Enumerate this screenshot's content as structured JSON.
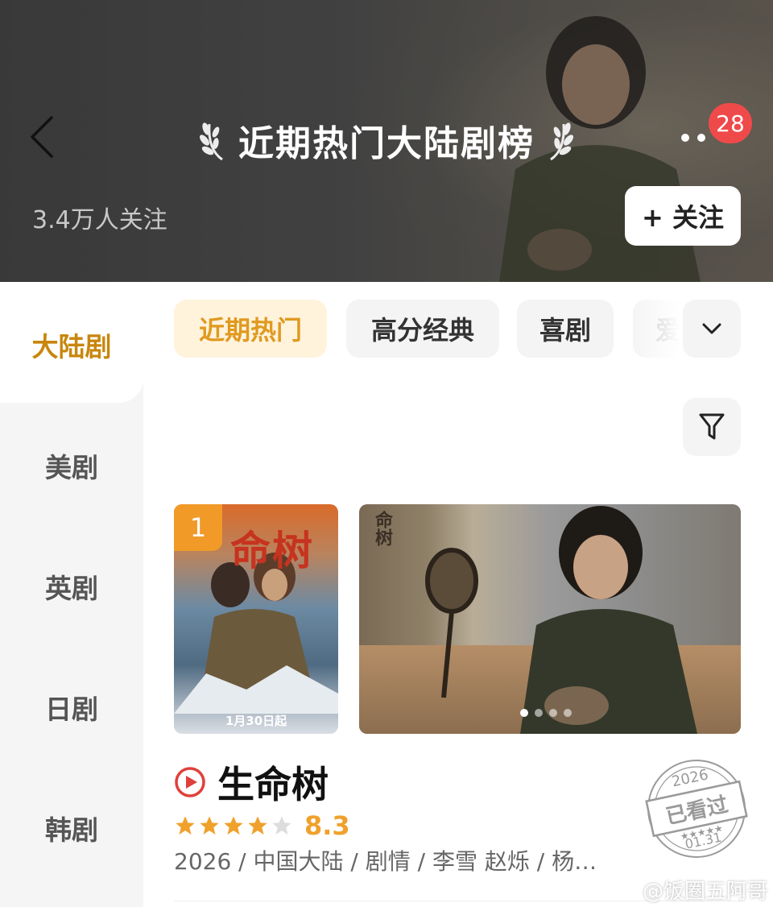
{
  "header": {
    "title": "近期热门大陆剧榜",
    "followers": "3.4万人关注",
    "follow_button": "+ 关注",
    "badge_count": "28"
  },
  "sidebar": {
    "items": [
      {
        "label": "大陆剧",
        "active": true
      },
      {
        "label": "美剧",
        "active": false
      },
      {
        "label": "英剧",
        "active": false
      },
      {
        "label": "日剧",
        "active": false
      },
      {
        "label": "韩剧",
        "active": false
      }
    ]
  },
  "chips": [
    {
      "label": "近期热门",
      "active": true
    },
    {
      "label": "高分经典",
      "active": false
    },
    {
      "label": "喜剧",
      "active": false
    },
    {
      "label": "爱",
      "active": false
    }
  ],
  "icons": {
    "expand": "chevron-down-icon",
    "filter": "filter-icon",
    "back": "back-arrow-icon",
    "more": "more-dots-icon",
    "play": "play-icon"
  },
  "item": {
    "rank": "1",
    "poster_title": "命树",
    "poster_date": "1月30日起",
    "still_text": "命树",
    "title": "生命树",
    "stars": 4,
    "rating": "8.3",
    "meta": "2026 / 中国大陆 / 剧情 / 李雪 赵烁 / 杨…",
    "carousel_total": 4,
    "carousel_index": 0
  },
  "stamp": {
    "year": "2026",
    "text": "已看过",
    "date": "01.31"
  },
  "watermark": "@饭圈五阿哥",
  "colors": {
    "accent": "#e09a20",
    "accent_bg": "#fff3dc",
    "badge": "#ef4a4a",
    "rank": "#f19a28",
    "star": "#f0a12b",
    "play": "#e0403a"
  }
}
